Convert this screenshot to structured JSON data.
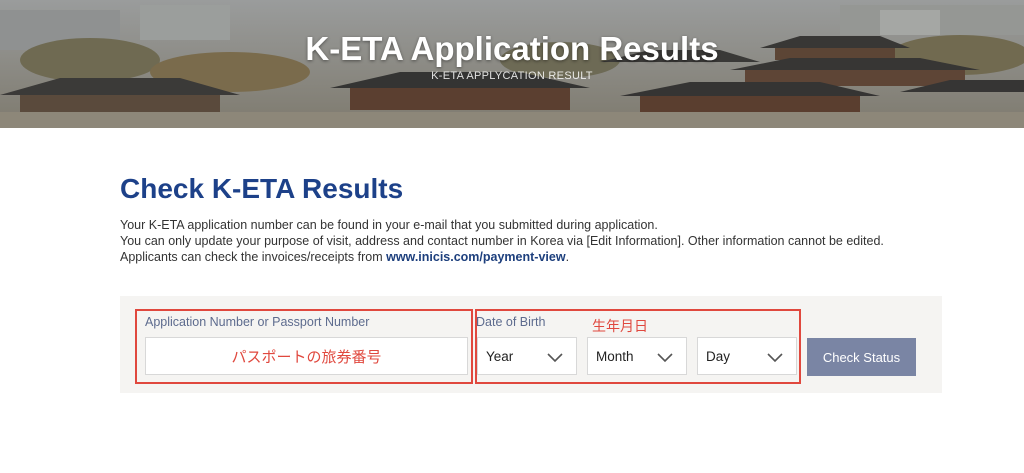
{
  "banner": {
    "title": "K-ETA Application Results",
    "subtitle": "K-ETA APPLYCATION RESULT"
  },
  "main": {
    "heading": "Check K-ETA Results",
    "desc_line1": "Your K-ETA application number can be found in your e-mail that you submitted during application.",
    "desc_line2": "You can only update your purpose of visit, address and contact number in Korea via [Edit Information]. Other information cannot be edited.",
    "desc_line3_prefix": "Applicants can check the invoices/receipts from ",
    "desc_link": "www.inicis.com/payment-view",
    "desc_line3_suffix": "."
  },
  "form": {
    "app_label": "Application Number or Passport Number",
    "app_annotation": "パスポートの旅券番号",
    "dob_label": "Date of Birth",
    "dob_annotation": "生年月日",
    "year_value": "Year",
    "month_value": "Month",
    "day_value": "Day",
    "submit_label": "Check Status"
  },
  "colors": {
    "heading": "#1d4189",
    "annotation": "#e0483e",
    "button": "#7a85a4",
    "panel": "#f5f4f2"
  }
}
